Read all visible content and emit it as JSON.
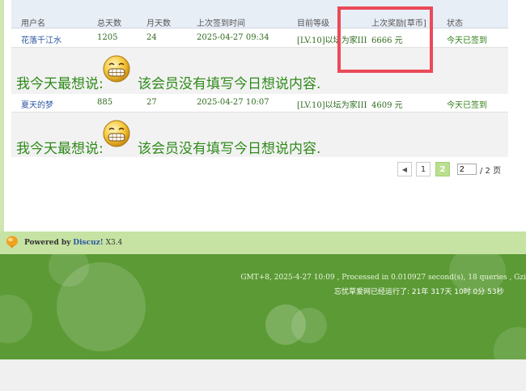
{
  "table": {
    "columns": [
      "用户名",
      "总天数",
      "月天数",
      "上次签到时间",
      "目前等级",
      "上次奖励[草币]",
      "状态"
    ],
    "rows": [
      {
        "username": "花落千江水",
        "total_days": "1205",
        "month_days": "24",
        "last_time": "2025-04-27 09:34",
        "level": "[LV.10]以坛为家III",
        "reward": "6666 元",
        "status": "今天已签到"
      },
      {
        "username": "夏天的梦",
        "total_days": "885",
        "month_days": "27",
        "last_time": "2025-04-27 10:07",
        "level": "[LV.10]以坛为家III",
        "reward": "4609 元",
        "status": "今天已签到"
      }
    ],
    "mood_label": "我今天最想说:",
    "mood_text": "该会员没有填写今日想说内容."
  },
  "pager": {
    "prev": "◀",
    "pages": [
      "1",
      "2"
    ],
    "current": "2",
    "input_value": "2",
    "total": "/ 2 页"
  },
  "footer": {
    "powered_prefix": "Powered by",
    "powered_brand": "Discuz!",
    "powered_version": "X3.4",
    "processed": "GMT+8, 2025-4-27 10:09 , Processed in 0.010927 second(s), 18 queries , Gzi",
    "runtime": "忘忧草爱网已经运行了: 21年 317天 10时 0分 53秒"
  },
  "colors": {
    "highlight_box": "#ea4a58",
    "mood_text": "#2f8a1a",
    "footer_bg": "#5b9a35",
    "powered_bg": "#c6e3a3",
    "pager_current": "#b9df8f"
  }
}
